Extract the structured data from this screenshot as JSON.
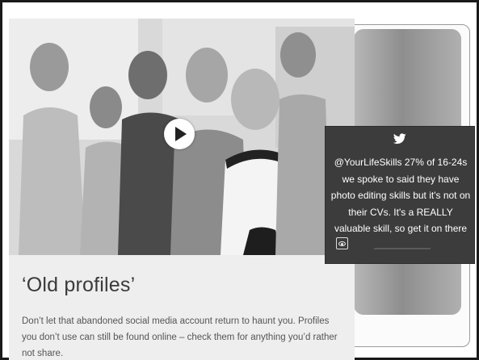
{
  "card": {
    "video": {
      "play_button_label": "Play video",
      "icon": "play-icon"
    },
    "headline": "‘Old profiles’",
    "body": "Don’t let that abandoned social media account return to haunt you. Profiles you don’t use can still be found online – check them for anything you’d rather not share."
  },
  "tweet": {
    "icon": "twitter-bird-icon",
    "text": "@YourLifeSkills 27% of 16-24s we spoke to said they have photo editing skills but it's not on their CVs. It's a REALLY valuable skill, so get it on there",
    "link_icon": "view-icon"
  },
  "colors": {
    "tweet_background": "#3c3c3c",
    "card_background": "#eeeeee",
    "headline": "#3a3a3a",
    "body_text": "#555555"
  }
}
